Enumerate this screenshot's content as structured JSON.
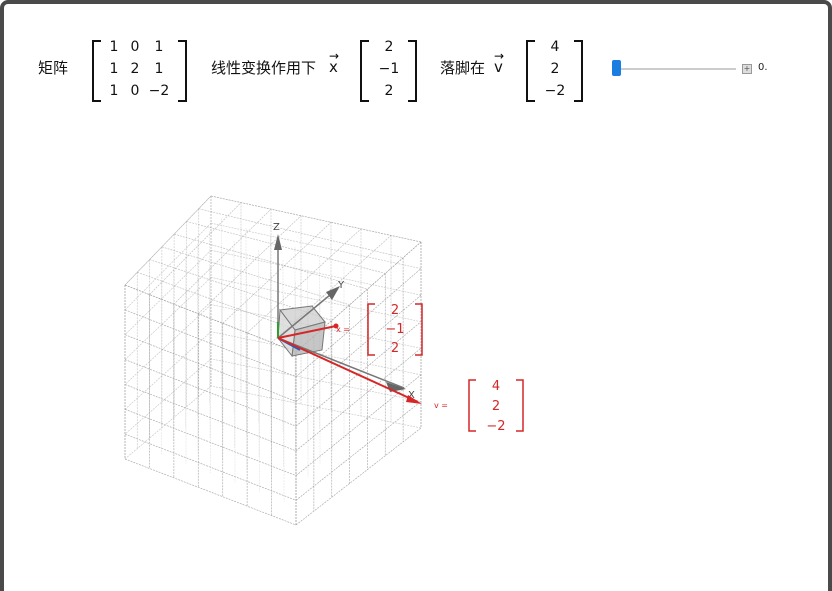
{
  "header": {
    "matrix_label": "矩阵",
    "transform_label": "线性变换作用下",
    "x_vec_name": "x",
    "lands_label": "落脚在",
    "v_vec_name": "v"
  },
  "matrix": [
    [
      "1",
      "0",
      "1"
    ],
    [
      "1",
      "2",
      "1"
    ],
    [
      "1",
      "0",
      "−2"
    ]
  ],
  "x_vector": [
    "2",
    "−1",
    "2"
  ],
  "v_vector": [
    "4",
    "2",
    "−2"
  ],
  "slider": {
    "value_label": "0.",
    "plus_label": "+"
  },
  "plot": {
    "axis_x": "X",
    "axis_y": "Y",
    "axis_z": "Z",
    "x_label": "x =",
    "v_label": "v =",
    "x_vector": [
      "2",
      "−1",
      "2"
    ],
    "v_vector": [
      "4",
      "2",
      "−2"
    ]
  },
  "colors": {
    "accent": "#1a7ee0",
    "vector_red": "#d62728",
    "grid": "#9a9a9a"
  }
}
